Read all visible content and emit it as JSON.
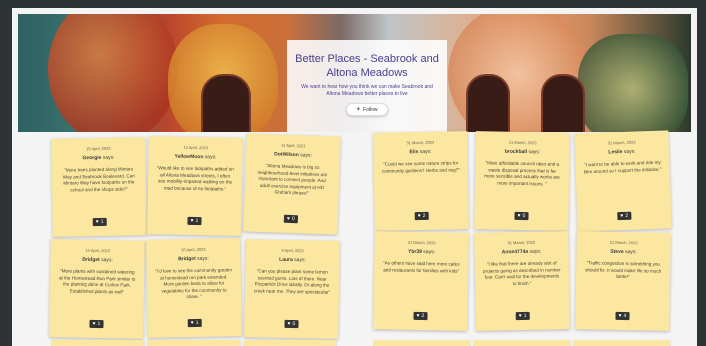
{
  "hero": {
    "title": "Better Places - Seabrook and Altona Meadows",
    "subtitle": "We want to hear how you think we can make Seabrook and Altona Meadows better places to live",
    "follow_label": "Follow"
  },
  "notes": [
    {
      "date": "15 April, 2023",
      "author": "Georgie",
      "says": "says:",
      "text": "\"More trees planted along Mintaro Way and Seabrook Boulevard. Can Mintaro Way have footpaths on the school and the shops side?\"",
      "likes": "1"
    },
    {
      "date": "13 April, 2023",
      "author": "YellowMoon",
      "says": "says:",
      "text": "\"Would like to see footpaths added on all Altona Meadows streets, I often see mobility-impaired walking on the road because of no footpaths.\"",
      "likes": "1"
    },
    {
      "date": "11 April, 2023",
      "author": "DotWilson",
      "says": "says:",
      "text": "\"Altona Meadows is big so neighbourhood-level initiatives are important to connect people. And adult exercise equipment at HD Graham please!\"",
      "likes": "0"
    },
    {
      "date": "10 April, 2023",
      "author": "Bridget",
      "says": "says:",
      "text": "\"More plants with sustained watering at the Homestead Run Park similar to the planting done at Curlew Park. Established plants as well\"",
      "likes": "1"
    },
    {
      "date": "10 April, 2023",
      "author": "Bridget",
      "says": "says:",
      "text": "\"I'd love to see the community garden at homestead run park extended. More garden beds to allow for vegetables for the community to share. \"",
      "likes": "1"
    },
    {
      "date": "9 April, 2023",
      "author": "Laura",
      "says": "says:",
      "text": "\"Can you please plant some lemon scented gums. Lots of them. Near Fitzpatrick Drive ideally. Or along the creek near me. They are spectacular\"",
      "likes": "0"
    },
    {
      "date": "31 March, 2023",
      "author": "Elis",
      "says": "says:",
      "text": "\"Could we see some nature strips for community gardens? Herbs and veg?\"",
      "likes": "2"
    },
    {
      "date": "31 March, 2023",
      "author": "brockball",
      "says": "says:",
      "text": "\"More affordable council rates and a waste disposal process that is far more sensible and actually works are more important issues. \"",
      "likes": "0"
    },
    {
      "date": "31 March, 2023",
      "author": "Leslie",
      "says": "says:",
      "text": "\"I want to be able to work and ride my bike around so I support the initiative.\"",
      "likes": "2"
    },
    {
      "date": "31 March, 2023",
      "author": "Ybr39",
      "says": "says:",
      "text": "\"As others have said here more cafes and restaurants for families with kids\"",
      "likes": "2"
    },
    {
      "date": "31 March, 2023",
      "author": "Anne4774a",
      "says": "says:",
      "text": "\"I like that there are already alot of projects going as described in number four. Can't wait for the developments to finish \"",
      "likes": "1"
    },
    {
      "date": "31 March, 2023",
      "author": "Steve",
      "says": "says:",
      "text": "\"Traffic congestion is something you should fix. It would make life so much better\"",
      "likes": "4"
    }
  ]
}
